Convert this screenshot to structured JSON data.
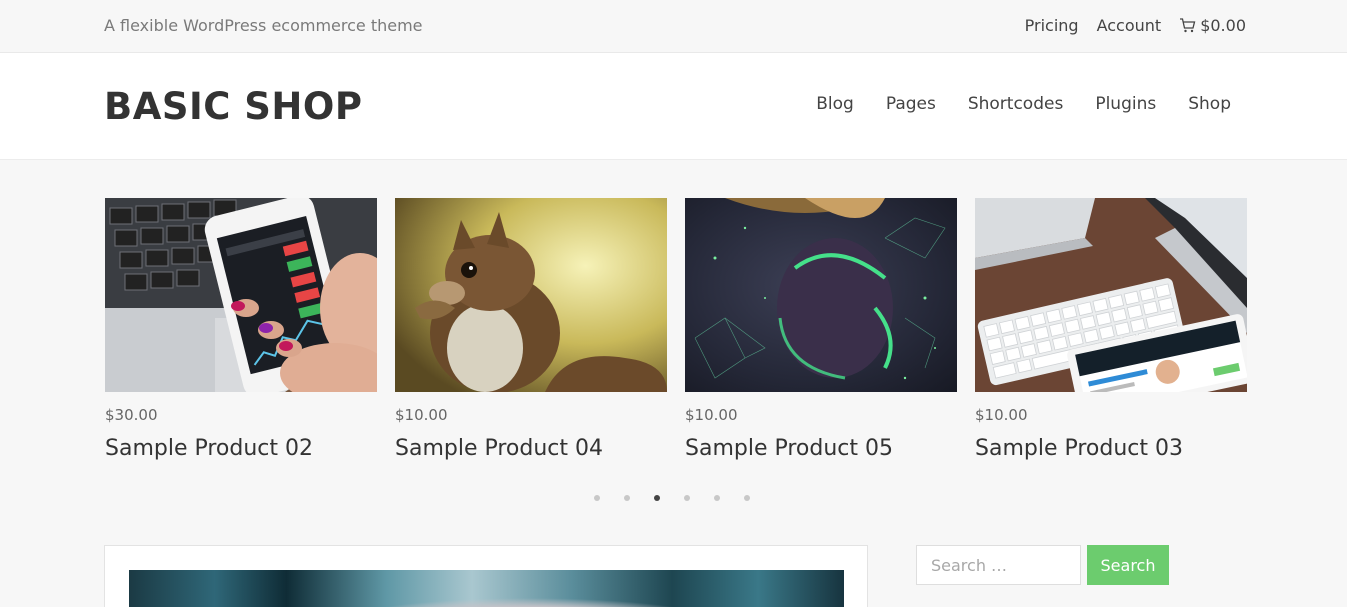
{
  "topbar": {
    "tagline": "A flexible WordPress ecommerce theme",
    "links": {
      "pricing": "Pricing",
      "account": "Account",
      "cart_total": "$0.00"
    }
  },
  "header": {
    "logo": "BASIC SHOP",
    "nav": [
      "Blog",
      "Pages",
      "Shortcodes",
      "Plugins",
      "Shop"
    ]
  },
  "products": [
    {
      "price": "$30.00",
      "title": "Sample Product 02",
      "image": "phone-stock-chart"
    },
    {
      "price": "$10.00",
      "title": "Sample Product 04",
      "image": "squirrel"
    },
    {
      "price": "$10.00",
      "title": "Sample Product 05",
      "image": "abstract-portrait"
    },
    {
      "price": "$10.00",
      "title": "Sample Product 03",
      "image": "keyboard-laptop"
    }
  ],
  "carousel": {
    "dot_count": 6,
    "active_index": 2
  },
  "sidebar": {
    "search_placeholder": "Search …",
    "search_button": "Search"
  },
  "colors": {
    "accent": "#6ccc6e",
    "background": "#f7f7f7"
  }
}
